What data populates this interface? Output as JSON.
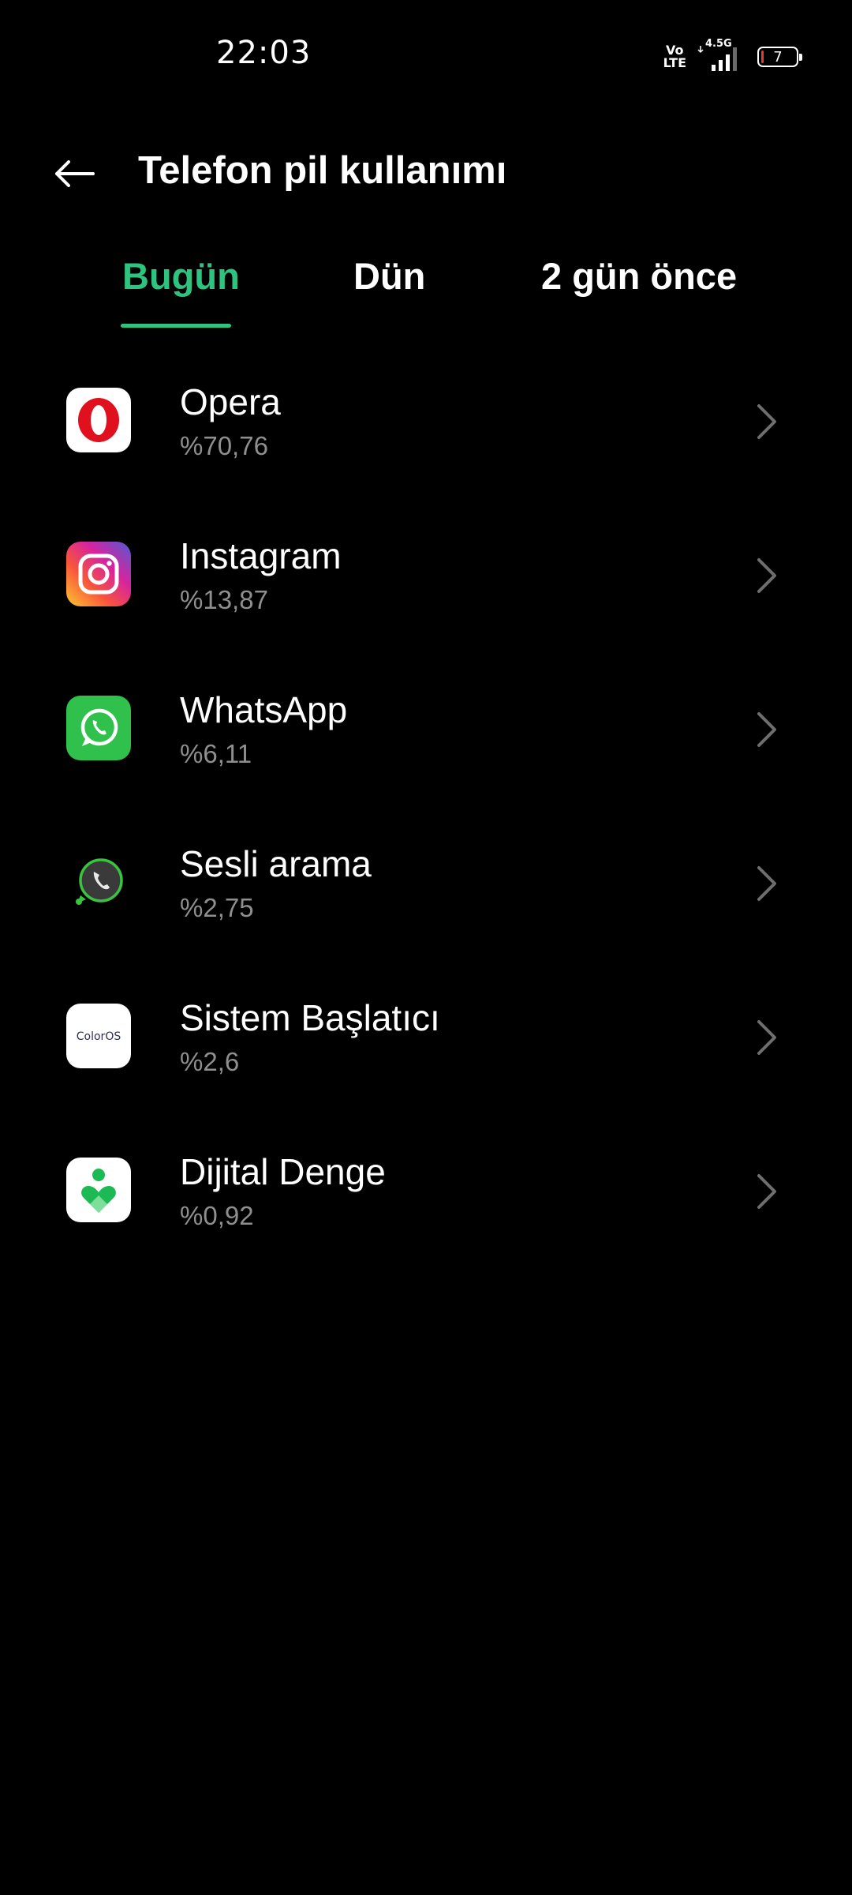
{
  "status_bar": {
    "time": "22:03",
    "volte": "Vo\nLTE",
    "network_type": "4.5G",
    "battery_level": "7",
    "battery_fraction": 0.07
  },
  "header": {
    "title": "Telefon pil kullanımı",
    "back_icon": "arrow-left-icon"
  },
  "tabs": [
    {
      "label": "Bugün",
      "active": true
    },
    {
      "label": "Dün",
      "active": false
    },
    {
      "label": "2 gün önce",
      "active": false
    }
  ],
  "apps": [
    {
      "name": "Opera",
      "usage": "%70,76",
      "icon": "opera-icon"
    },
    {
      "name": "Instagram",
      "usage": "%13,87",
      "icon": "instagram-icon"
    },
    {
      "name": "WhatsApp",
      "usage": "%6,11",
      "icon": "whatsapp-icon"
    },
    {
      "name": "Sesli arama",
      "usage": "%2,75",
      "icon": "voice-call-icon"
    },
    {
      "name": "Sistem Başlatıcı",
      "usage": "%2,6",
      "icon": "coloros-launcher-icon"
    },
    {
      "name": "Dijital Denge",
      "usage": "%0,92",
      "icon": "digital-wellbeing-icon"
    }
  ],
  "icon_labels": {
    "coloros": "ColorOS"
  },
  "colors": {
    "accent": "#2dc480",
    "background": "#000000",
    "secondary_text": "#8f8f8f",
    "battery_low": "#e53935"
  }
}
